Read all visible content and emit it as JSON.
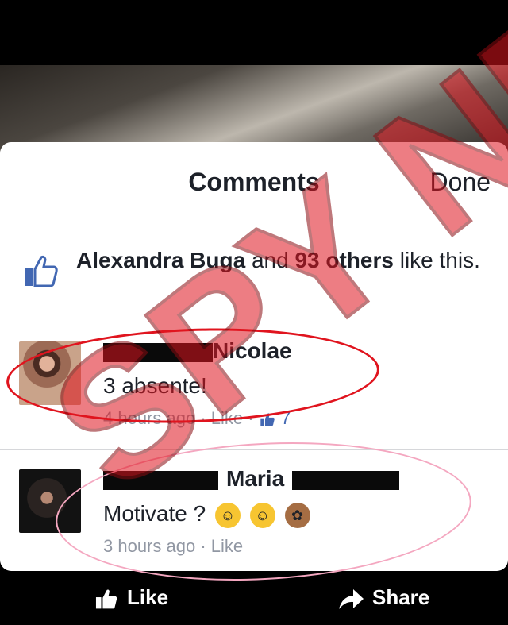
{
  "header": {
    "title": "Comments",
    "done_label": "Done"
  },
  "likes": {
    "name": "Alexandra Buga",
    "middle": " and ",
    "others": "93 others",
    "suffix": " like this."
  },
  "comments": [
    {
      "name": "Nicolae",
      "text": "3 absente!",
      "time": "4 hours ago",
      "like": "Like",
      "count": "7"
    },
    {
      "name": "Maria",
      "text": "Motivate ?",
      "time": "3 hours ago",
      "like": "Like"
    }
  ],
  "bottom": {
    "like_label": "Like",
    "share_label": "Share"
  },
  "watermark": {
    "text": "SPY NEWS"
  },
  "colors": {
    "accent": "#4267b2",
    "annotation_red": "#e0141e",
    "annotation_pink": "#f4a7c0"
  }
}
